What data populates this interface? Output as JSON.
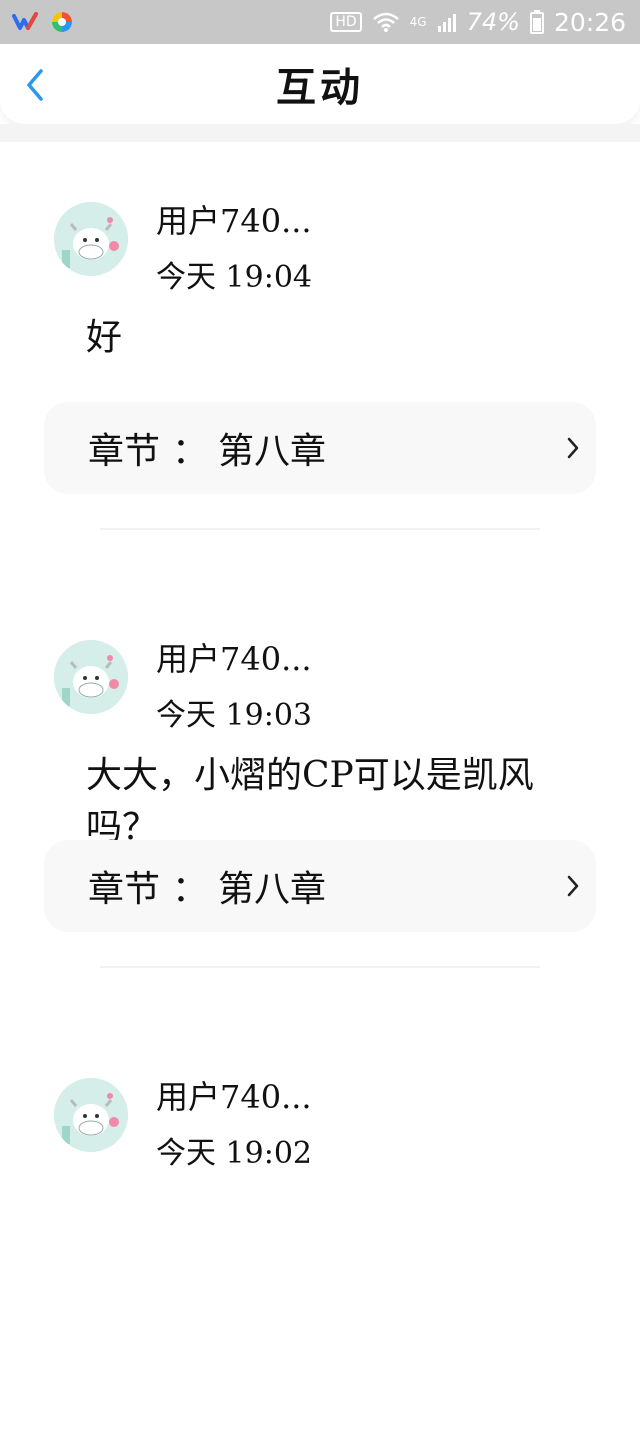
{
  "status_bar": {
    "hd": "HD",
    "network": "4G",
    "battery": "74%",
    "time": "20:26"
  },
  "header": {
    "title": "互动"
  },
  "chapter_label": "章节",
  "chapter_sep": "：",
  "posts": [
    {
      "user": "用户740...",
      "time": "今天 19:04",
      "text": "好",
      "chapter": "第八章"
    },
    {
      "user": "用户740...",
      "time": "今天 19:03",
      "text": "大大，小熠的CP可以是凯风吗？",
      "chapter": "第八章"
    },
    {
      "user": "用户740...",
      "time": "今天 19:02"
    }
  ],
  "colors": {
    "accent": "#2b97f0",
    "status_bar_bg": "#c7c7c7",
    "card_bg": "#f8f8f8"
  }
}
